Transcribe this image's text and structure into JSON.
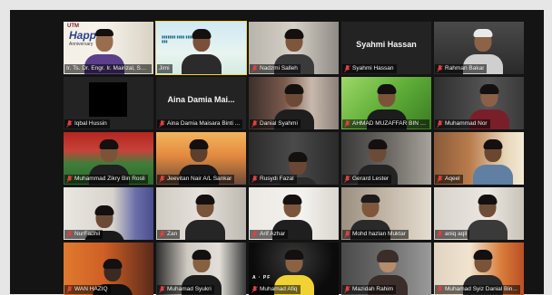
{
  "meeting": {
    "tiles": [
      {
        "name": "Ir. Ts. Dr. Engr. Ir. Mairizal, ST, MT, IPU",
        "muted": false
      },
      {
        "name": "Jimi",
        "muted": false
      },
      {
        "name": "Nadzmi Salleh",
        "muted": true
      },
      {
        "name": "Syahmi Hassan",
        "display": "Syahmi Hassan",
        "muted": true
      },
      {
        "name": "Rahman Bakar",
        "muted": true
      },
      {
        "name": "Iqbal Hussin",
        "muted": true
      },
      {
        "name": "Aina Damia Maisara Binti ...",
        "display": "Aina Damia Mai...",
        "muted": true
      },
      {
        "name": "Danial Syahmi",
        "muted": true
      },
      {
        "name": "AHMAD MUZAFFAR BIN M...",
        "muted": true
      },
      {
        "name": "Muhammad Nor",
        "muted": true
      },
      {
        "name": "Muhammad Zikry Bin Rosli",
        "muted": true
      },
      {
        "name": "Jeevitan Nair A/L Sankar",
        "muted": true
      },
      {
        "name": "Rusydi Fazal",
        "muted": true
      },
      {
        "name": "Gerard Lester",
        "muted": true
      },
      {
        "name": "Aqeel",
        "muted": true
      },
      {
        "name": "NurFadhil",
        "muted": true
      },
      {
        "name": "Zan",
        "muted": true
      },
      {
        "name": "Arif Azhar",
        "muted": true
      },
      {
        "name": "Mohd hazlan Muktar",
        "muted": true
      },
      {
        "name": "aniq aqil",
        "muted": true
      },
      {
        "name": "WAN HAZIQ",
        "muted": true
      },
      {
        "name": "Muhamad Syukri",
        "muted": true
      },
      {
        "name": "Muhamad Afiq",
        "muted": true
      },
      {
        "name": "Mazidah Rahim",
        "muted": true
      },
      {
        "name": "Muhamad Syiz Danial Bin...",
        "muted": true
      }
    ]
  },
  "decor": {
    "poster_title": "Happy",
    "poster_sub": "Anniversary",
    "logo": "UTM",
    "stamp_text": "A  ·  PF"
  },
  "colors": {
    "window_bg": "#141414",
    "tile_bg": "#232323",
    "active_speaker": "#f3d245",
    "muted_icon": "#e04040"
  }
}
